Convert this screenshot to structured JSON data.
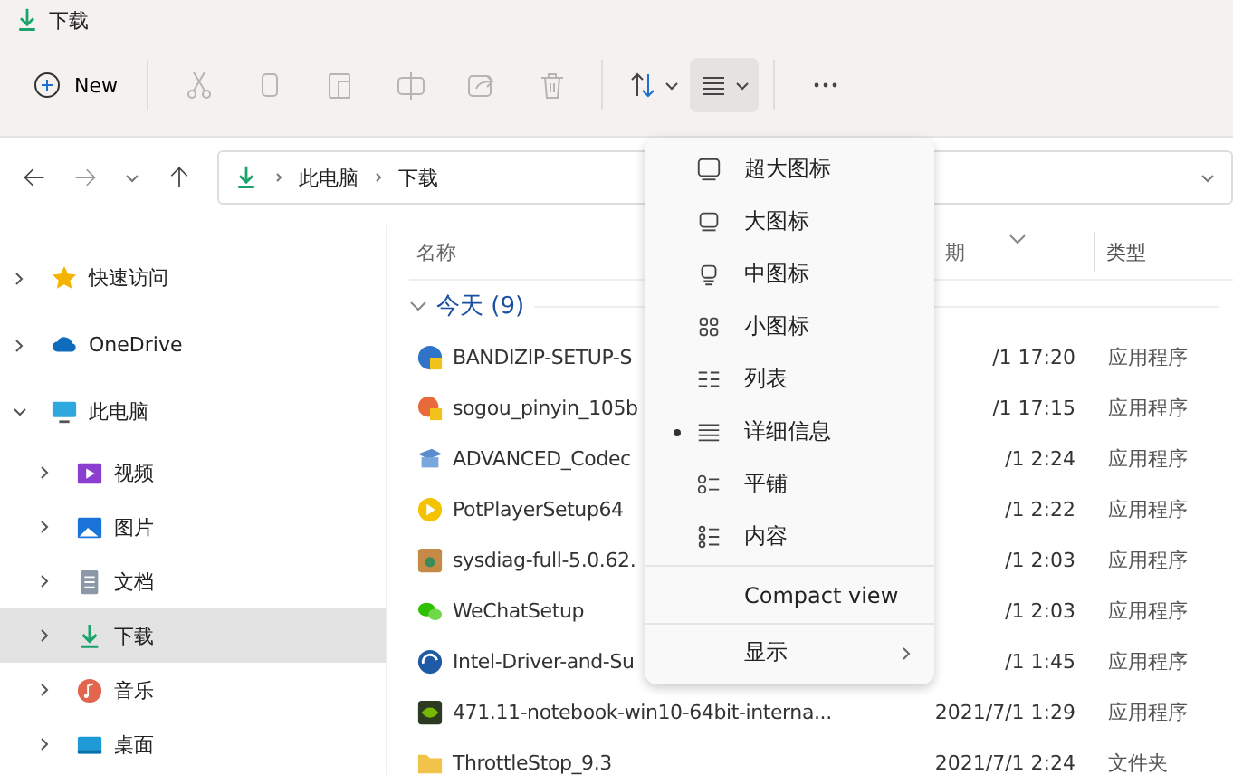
{
  "window": {
    "title": "下载"
  },
  "toolbar": {
    "new_label": "New",
    "tools": [
      {
        "kind": "cut",
        "disabled": true
      },
      {
        "kind": "copy",
        "disabled": true
      },
      {
        "kind": "paste",
        "disabled": true
      },
      {
        "kind": "rename",
        "disabled": true
      },
      {
        "kind": "share",
        "disabled": true
      },
      {
        "kind": "delete",
        "disabled": true
      },
      {
        "kind": "sort",
        "disabled": false
      },
      {
        "kind": "view",
        "disabled": false
      },
      {
        "kind": "more",
        "disabled": false
      }
    ]
  },
  "address_bar": {
    "path": [
      "此电脑",
      "下载"
    ]
  },
  "sidebar": {
    "items": [
      {
        "kind": "star",
        "label": "快速访问",
        "expanded": false,
        "selected": false
      },
      {
        "kind": "cloud",
        "label": "OneDrive",
        "expanded": false,
        "selected": false
      },
      {
        "kind": "pc",
        "label": "此电脑",
        "expanded": true,
        "selected": false,
        "children": [
          {
            "kind": "video",
            "label": "视频",
            "expanded": false,
            "selected": false
          },
          {
            "kind": "picture",
            "label": "图片",
            "expanded": false,
            "selected": false
          },
          {
            "kind": "document",
            "label": "文档",
            "expanded": false,
            "selected": false
          },
          {
            "kind": "download",
            "label": "下载",
            "expanded": false,
            "selected": true
          },
          {
            "kind": "music",
            "label": "音乐",
            "expanded": false,
            "selected": false
          },
          {
            "kind": "desktop",
            "label": "桌面",
            "expanded": false,
            "selected": false
          }
        ]
      }
    ]
  },
  "table": {
    "columns": [
      "名称",
      "期",
      "类型"
    ],
    "group": {
      "label": "今天 (9)",
      "expanded": true
    },
    "rows": [
      {
        "kind": "installer",
        "name": "BANDIZIP-SETUP-S",
        "date": "/1 17:20",
        "type": "应用程序"
      },
      {
        "kind": "sogou",
        "name": "sogou_pinyin_105b",
        "date": "/1 17:15",
        "type": "应用程序"
      },
      {
        "kind": "codec",
        "name": "ADVANCED_Codec",
        "date": "/1 2:24",
        "type": "应用程序"
      },
      {
        "kind": "player",
        "name": "PotPlayerSetup64",
        "date": "/1 2:22",
        "type": "应用程序"
      },
      {
        "kind": "sysdiag",
        "name": "sysdiag-full-5.0.62.",
        "date": "/1 2:03",
        "type": "应用程序"
      },
      {
        "kind": "wechat",
        "name": "WeChatSetup",
        "date": "/1 2:03",
        "type": "应用程序"
      },
      {
        "kind": "intel",
        "name": "Intel-Driver-and-Su",
        "date": "/1 1:45",
        "type": "应用程序"
      },
      {
        "kind": "nvidia",
        "name": "471.11-notebook-win10-64bit-interna...",
        "date": "2021/7/1 1:29",
        "type": "应用程序"
      },
      {
        "kind": "folder",
        "name": "ThrottleStop_9.3",
        "date": "2021/7/1 2:24",
        "type": "文件夹"
      }
    ]
  },
  "view_menu": {
    "items": [
      {
        "kind": "xl",
        "label": "超大图标",
        "selected": false
      },
      {
        "kind": "large",
        "label": "大图标",
        "selected": false
      },
      {
        "kind": "medium",
        "label": "中图标",
        "selected": false
      },
      {
        "kind": "small",
        "label": "小图标",
        "selected": false
      },
      {
        "kind": "list",
        "label": "列表",
        "selected": false
      },
      {
        "kind": "details",
        "label": "详细信息",
        "selected": true
      },
      {
        "kind": "tiles",
        "label": "平铺",
        "selected": false
      },
      {
        "kind": "content",
        "label": "内容",
        "selected": false
      }
    ],
    "compact_label": "Compact view",
    "show_label": "显示"
  }
}
